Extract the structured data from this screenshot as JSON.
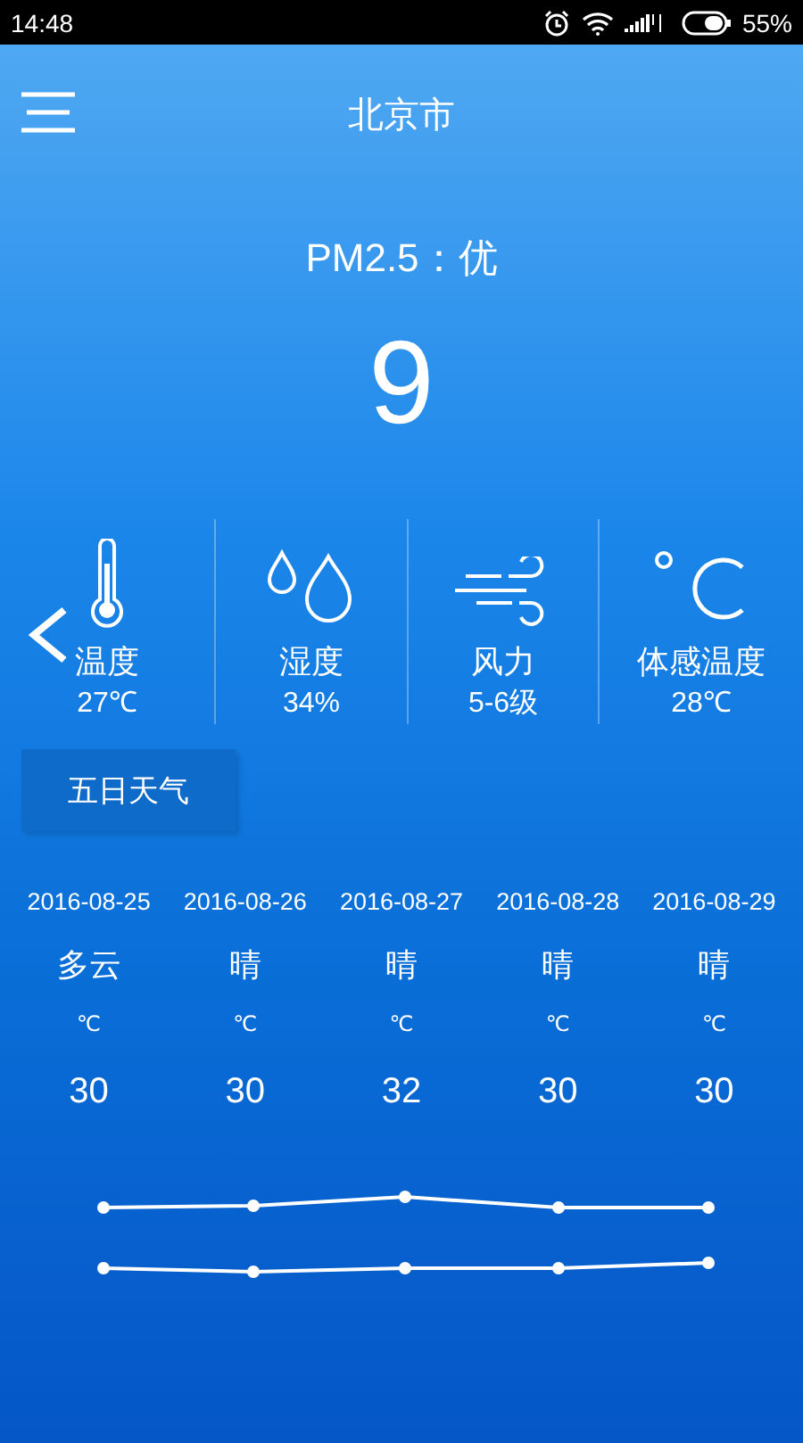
{
  "status_bar": {
    "time": "14:48",
    "battery": "55%"
  },
  "header": {
    "title": "北京市"
  },
  "air": {
    "label": "PM2.5：优",
    "value": "9"
  },
  "metrics": [
    {
      "kind": "thermometer",
      "label": "温度",
      "value": "27℃"
    },
    {
      "kind": "drops",
      "label": "湿度",
      "value": "34%"
    },
    {
      "kind": "wind",
      "label": "风力",
      "value": "5-6级"
    },
    {
      "kind": "celsius",
      "label": "体感温度",
      "value": "28℃"
    }
  ],
  "section_tab": {
    "label": "五日天气"
  },
  "forecast": [
    {
      "date": "2016-08-25",
      "weather": "多云",
      "unit": "℃",
      "temp": "30"
    },
    {
      "date": "2016-08-26",
      "weather": "晴",
      "unit": "℃",
      "temp": "30"
    },
    {
      "date": "2016-08-27",
      "weather": "晴",
      "unit": "℃",
      "temp": "32"
    },
    {
      "date": "2016-08-28",
      "weather": "晴",
      "unit": "℃",
      "temp": "30"
    },
    {
      "date": "2016-08-29",
      "weather": "晴",
      "unit": "℃",
      "temp": "30"
    }
  ]
}
